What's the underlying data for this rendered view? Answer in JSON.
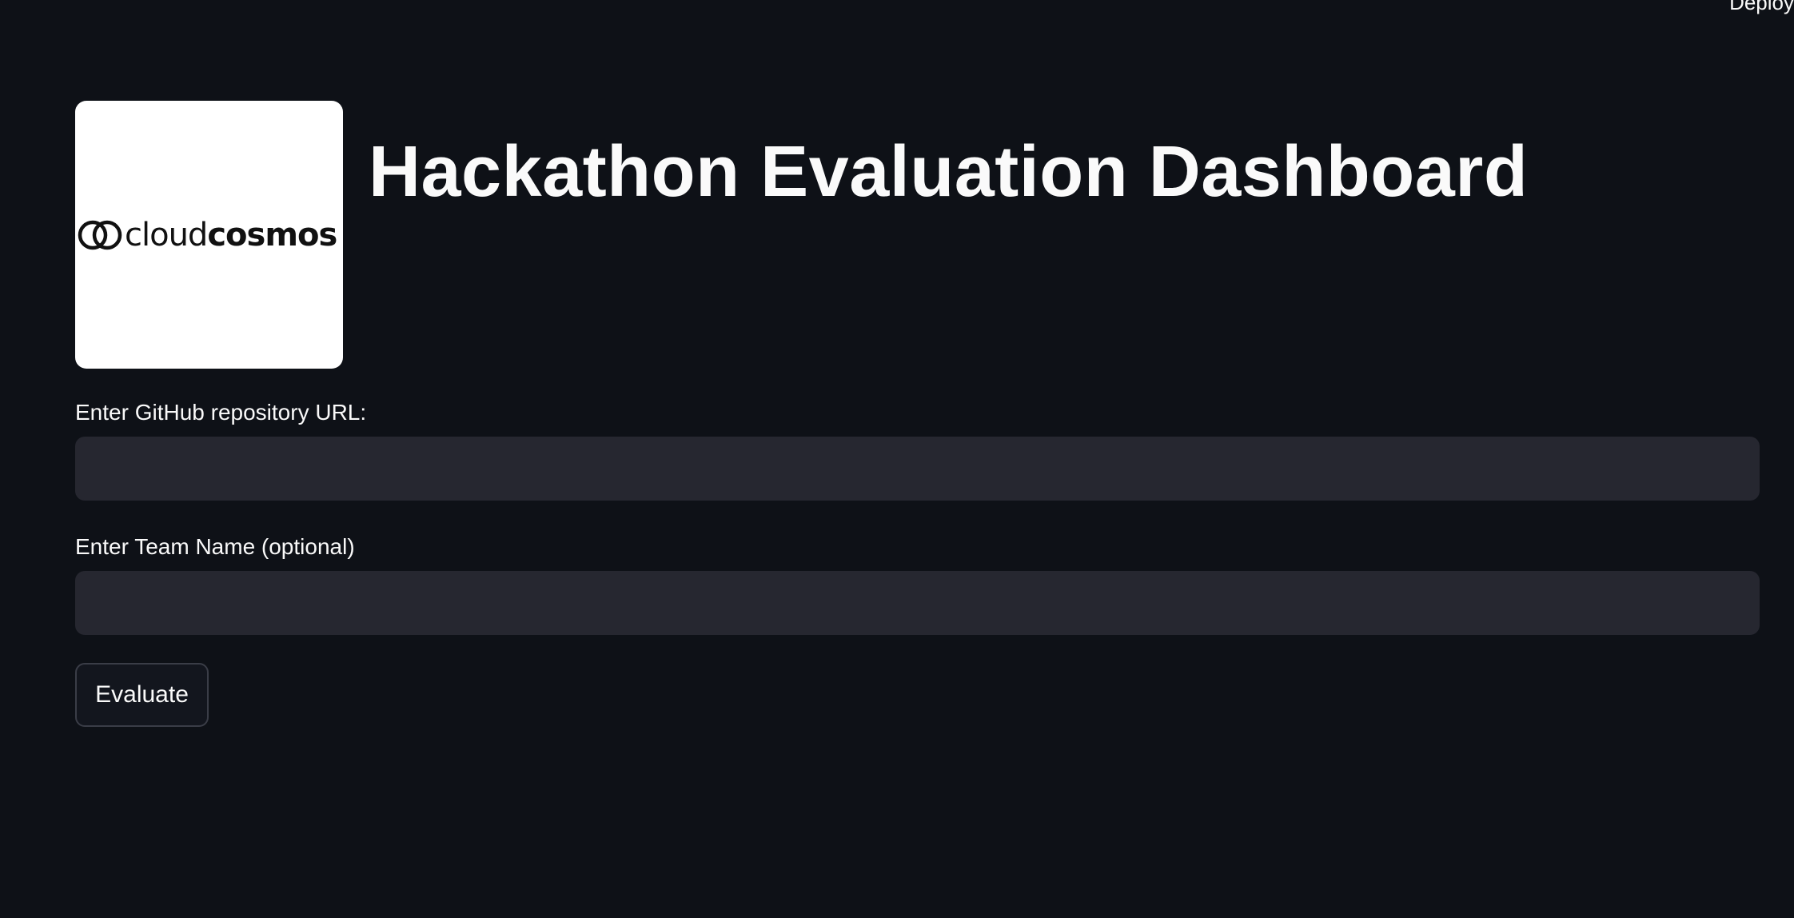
{
  "header": {
    "deploy_label": "Deploy"
  },
  "logo": {
    "text_light": "cloud",
    "text_bold": "cosmos"
  },
  "main": {
    "title": "Hackathon Evaluation Dashboard",
    "repo_field": {
      "label": "Enter GitHub repository URL:",
      "value": "",
      "placeholder": ""
    },
    "team_field": {
      "label": "Enter Team Name (optional)",
      "value": "",
      "placeholder": ""
    },
    "evaluate_label": "Evaluate"
  },
  "colors": {
    "background": "#0e1117",
    "input_bg": "#262730",
    "text": "#fafafa",
    "button_border": "#3a3d47"
  }
}
